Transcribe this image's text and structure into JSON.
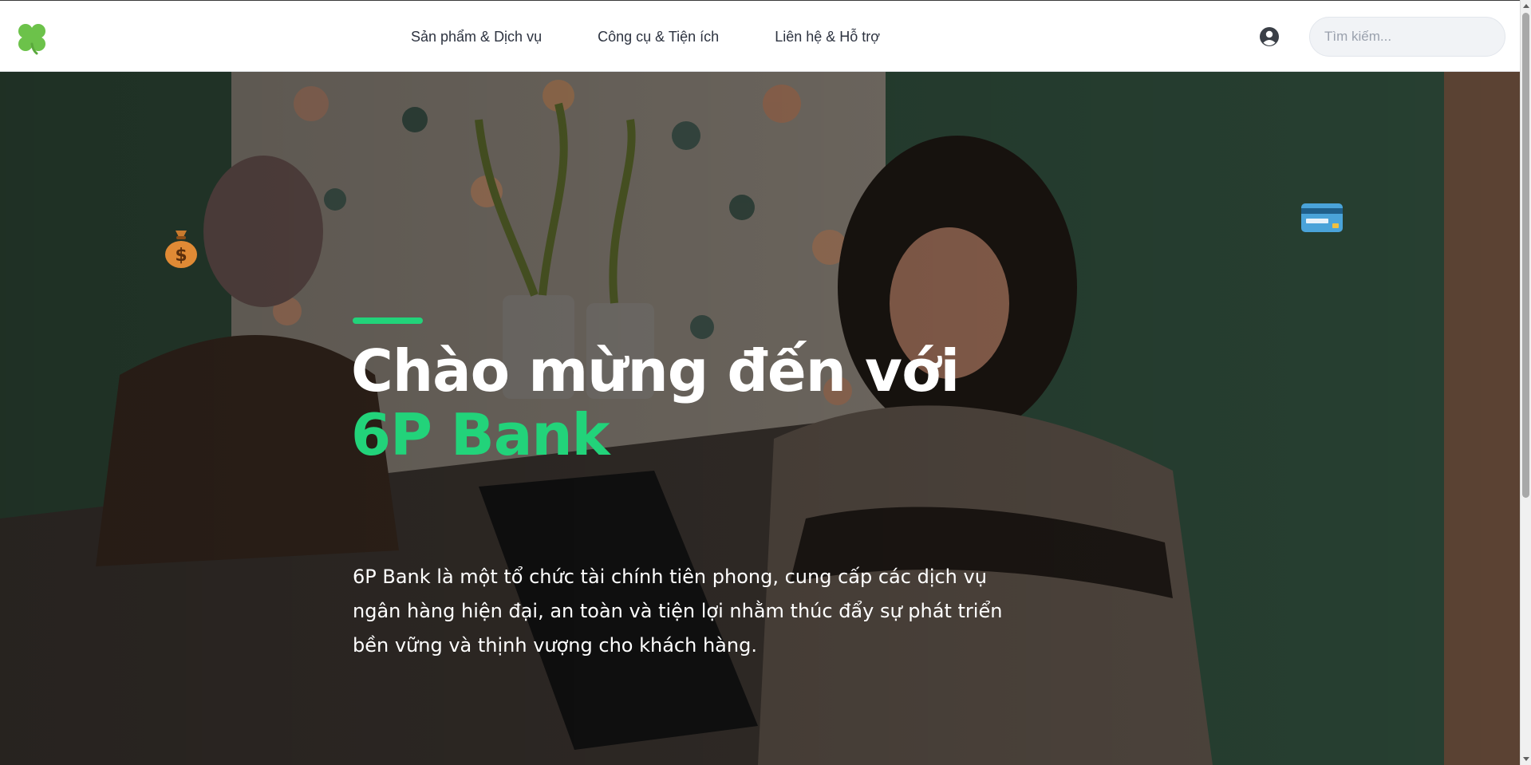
{
  "header": {
    "nav": [
      {
        "label": "Sản phẩm & Dịch vụ"
      },
      {
        "label": "Công cụ & Tiện ích"
      },
      {
        "label": "Liên hệ & Hỗ trợ"
      }
    ],
    "search_placeholder": "Tìm kiếm...",
    "logo_icon": "four-leaf-clover-icon",
    "user_icon": "user-circle-icon"
  },
  "hero": {
    "title_line1": "Chào mừng đến với",
    "title_line2": "6P Bank",
    "description": "6P Bank là một tổ chức tài chính tiên phong, cung cấp các dịch vụ ngân hàng hiện đại, an toàn và tiện lợi nhằm thúc đẩy sự phát triển bền vững và thịnh vượng cho khách hàng.",
    "decor_icons": [
      "money-bag-icon",
      "credit-card-icon"
    ]
  },
  "colors": {
    "accent": "#22d37a",
    "logo_green": "#6cc24a",
    "nav_text": "#2d3340",
    "header_bg": "#ffffff"
  }
}
